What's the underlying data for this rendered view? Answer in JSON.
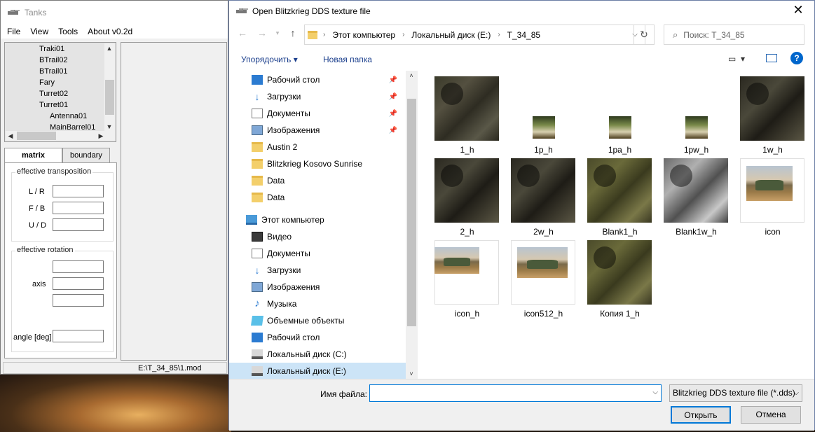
{
  "tanks": {
    "title": "Tanks",
    "menu": [
      "File",
      "View",
      "Tools",
      "About v0.2d"
    ],
    "tree": [
      {
        "label": "Traki01",
        "indent": 1
      },
      {
        "label": "BTrail02",
        "indent": 1
      },
      {
        "label": "BTrail01",
        "indent": 1
      },
      {
        "label": "Fary",
        "indent": 1
      },
      {
        "label": "Turret02",
        "indent": 1
      },
      {
        "label": "Turret01",
        "indent": 1
      },
      {
        "label": "Antenna01",
        "indent": 2
      },
      {
        "label": "MainBarrel01",
        "indent": 2
      }
    ],
    "tabs": {
      "matrix": "matrix",
      "boundary": "boundary"
    },
    "groups": {
      "transposition": "effective transposition",
      "rotation": "effective rotation"
    },
    "labels": {
      "lr": "L / R",
      "fb": "F / B",
      "ud": "U / D",
      "axis": "axis",
      "angle": "angle [deg]"
    },
    "status": "E:\\T_34_85\\1.mod"
  },
  "dialog": {
    "title": "Open Blitzkrieg DDS texture file",
    "close": "✕",
    "address": {
      "root": "Этот компьютер",
      "drive": "Локальный диск (E:)",
      "folder": "T_34_85"
    },
    "search_placeholder": "Поиск: T_34_85",
    "toolbar": {
      "organize": "Упорядочить",
      "new_folder": "Новая папка"
    },
    "nav": [
      {
        "label": "Рабочий стол",
        "icon": "desktop",
        "pinned": true,
        "indent": 1
      },
      {
        "label": "Загрузки",
        "icon": "download",
        "pinned": true,
        "indent": 1
      },
      {
        "label": "Документы",
        "icon": "doc",
        "pinned": true,
        "indent": 1
      },
      {
        "label": "Изображения",
        "icon": "img",
        "pinned": true,
        "indent": 1
      },
      {
        "label": "Austin 2",
        "icon": "folder",
        "pinned": false,
        "indent": 1
      },
      {
        "label": "Blitzkrieg Kosovo Sunrise",
        "icon": "folder",
        "pinned": false,
        "indent": 1
      },
      {
        "label": "Data",
        "icon": "folder",
        "pinned": false,
        "indent": 1
      },
      {
        "label": "Data",
        "icon": "folder",
        "pinned": false,
        "indent": 1
      },
      {
        "label": "Этот компьютер",
        "icon": "pc",
        "pinned": false,
        "indent": 0
      },
      {
        "label": "Видео",
        "icon": "video",
        "pinned": false,
        "indent": 1
      },
      {
        "label": "Документы",
        "icon": "doc",
        "pinned": false,
        "indent": 1
      },
      {
        "label": "Загрузки",
        "icon": "download",
        "pinned": false,
        "indent": 1
      },
      {
        "label": "Изображения",
        "icon": "img",
        "pinned": false,
        "indent": 1
      },
      {
        "label": "Музыка",
        "icon": "music",
        "pinned": false,
        "indent": 1
      },
      {
        "label": "Объемные объекты",
        "icon": "3d",
        "pinned": false,
        "indent": 1
      },
      {
        "label": "Рабочий стол",
        "icon": "desktop",
        "pinned": false,
        "indent": 1
      },
      {
        "label": "Локальный диск (C:)",
        "icon": "disk",
        "pinned": false,
        "indent": 1
      },
      {
        "label": "Локальный диск (E:)",
        "icon": "disk",
        "pinned": false,
        "indent": 1,
        "selected": true
      }
    ],
    "files": [
      {
        "name": "1_h",
        "kind": "dark"
      },
      {
        "name": "1p_h",
        "kind": "small"
      },
      {
        "name": "1pa_h",
        "kind": "small"
      },
      {
        "name": "1pw_h",
        "kind": "small"
      },
      {
        "name": "1w_h",
        "kind": "pale"
      },
      {
        "name": "2_h",
        "kind": "dark2"
      },
      {
        "name": "2w_h",
        "kind": "pale"
      },
      {
        "name": "Blank1_h",
        "kind": "green"
      },
      {
        "name": "Blank1w_h",
        "kind": "grey"
      },
      {
        "name": "icon",
        "kind": "img-small"
      },
      {
        "name": "icon_h",
        "kind": "img-wide"
      },
      {
        "name": "icon512_h",
        "kind": "img-wide"
      },
      {
        "name": "Копия 1_h",
        "kind": "green2"
      }
    ],
    "filename_label": "Имя файла:",
    "filename_value": "",
    "filter": "Blitzkrieg DDS texture file (*.dds)",
    "open": "Открыть",
    "cancel": "Отмена"
  }
}
